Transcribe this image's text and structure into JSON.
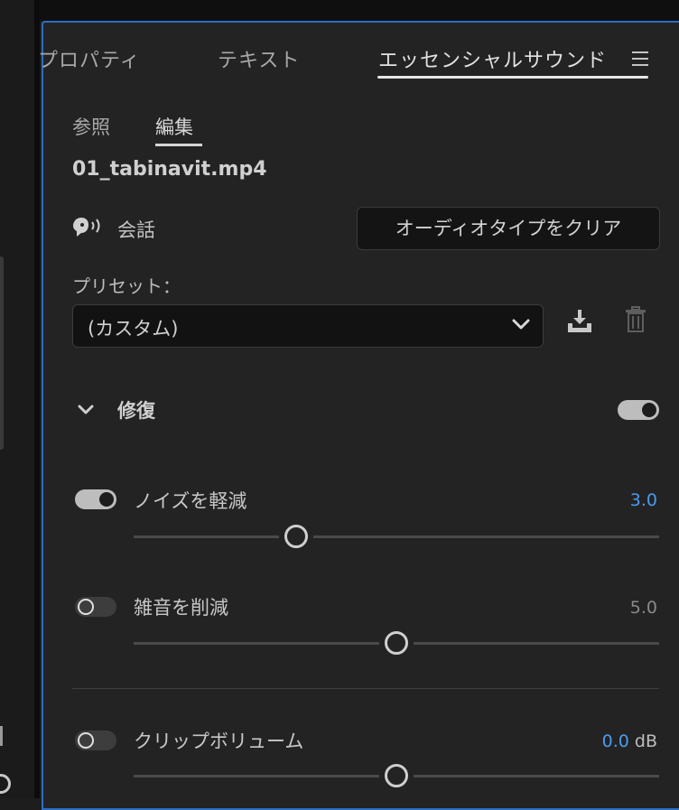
{
  "tabs": [
    {
      "label": "プロパティ"
    },
    {
      "label": "テキスト"
    },
    {
      "label": "エッセンシャルサウンド"
    }
  ],
  "subtabs": [
    {
      "label": "参照"
    },
    {
      "label": "編集"
    }
  ],
  "clip": {
    "filename": "01_tabinavit.mp4"
  },
  "audio_type": {
    "label": "会話",
    "clear_button": "オーディオタイプをクリア"
  },
  "preset": {
    "label": "プリセット：",
    "value": "(カスタム)"
  },
  "repair": {
    "title": "修復",
    "enabled": true
  },
  "controls": [
    {
      "label": "ノイズを軽減",
      "value": "3.0",
      "enabled": true,
      "level": 0.31
    },
    {
      "label": "雑音を削減",
      "value": "5.0",
      "enabled": false,
      "level": 0.5
    },
    {
      "label": "クリップボリューム",
      "value": "0.0",
      "unit": "dB",
      "enabled": false,
      "level": 0.5
    }
  ],
  "colors": {
    "accent": "#4a9cf0",
    "panel_border": "#2d6fbf",
    "muted_value": "#8a8a8a"
  },
  "icons": [
    "hamburger-menu-icon",
    "dialogue-icon",
    "chevron-down-icon",
    "save-preset-icon",
    "trash-icon"
  ]
}
